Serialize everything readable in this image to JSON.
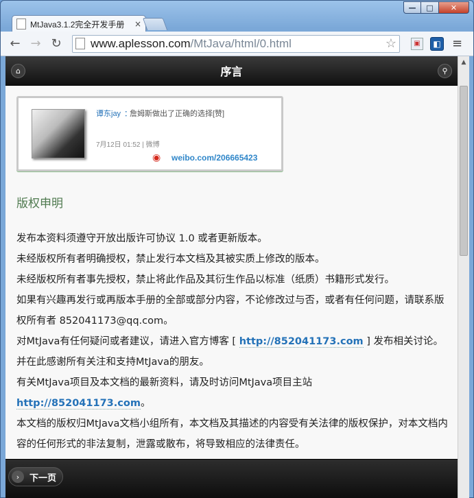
{
  "browser": {
    "tab_title": "MtJava3.1.2完全开发手册",
    "tab_close": "×",
    "url_host": "www.aplesson.com",
    "url_path": "/MtJava/html/0.html",
    "back_icon": "←",
    "forward_icon": "→",
    "reload_icon": "↻",
    "star_icon": "☆",
    "menu_icon": "≡"
  },
  "window_controls": {
    "min": "—",
    "max": "□",
    "close": "✕"
  },
  "page": {
    "header_title": "序言",
    "home_icon": "⌂",
    "search_icon": "⚲"
  },
  "weibo": {
    "name": "谭东jay",
    "colon": "：",
    "post": "詹姆斯做出了正确的选择[赞]",
    "meta": "7月12日 01:52 | 微博",
    "logo_icon": "◉",
    "url": "weibo.com/206665423"
  },
  "section": {
    "heading": "版权申明",
    "line1": "发布本资料须遵守开放出版许可协议 1.0 或者更新版本。",
    "line2": "未经版权所有者明确授权，禁止发行本文档及其被实质上修改的版本。",
    "line3": "未经版权所有者事先授权，禁止将此作品及其衍生作品以标准（纸质）书籍形式发行。",
    "line4": "如果有兴趣再发行或再版本手册的全部或部分内容，不论修改过与否，或者有任何问题，请联系版权所有者 852041173@qq.com。",
    "line5a": "对MtJava有任何疑问或者建议，请进入官方博客 [ ",
    "link1": "http://852041173.com",
    "line5b": " ] 发布相关讨论。",
    "line6": "并在此感谢所有关注和支持MtJava的朋友。",
    "line7a": "有关MtJava项目及本文档的最新资料，请及时访问MtJava项目主站 ",
    "link2": "http://852041173.com",
    "line7b": "。",
    "line8": "本文档的版权归MtJava文档小组所有，本文档及其描述的内容受有关法律的版权保护，对本文档内容的任何形式的非法复制，泄露或散布，将导致相应的法律责任。"
  },
  "footer": {
    "next_icon": "›",
    "next_label": "下一页"
  }
}
